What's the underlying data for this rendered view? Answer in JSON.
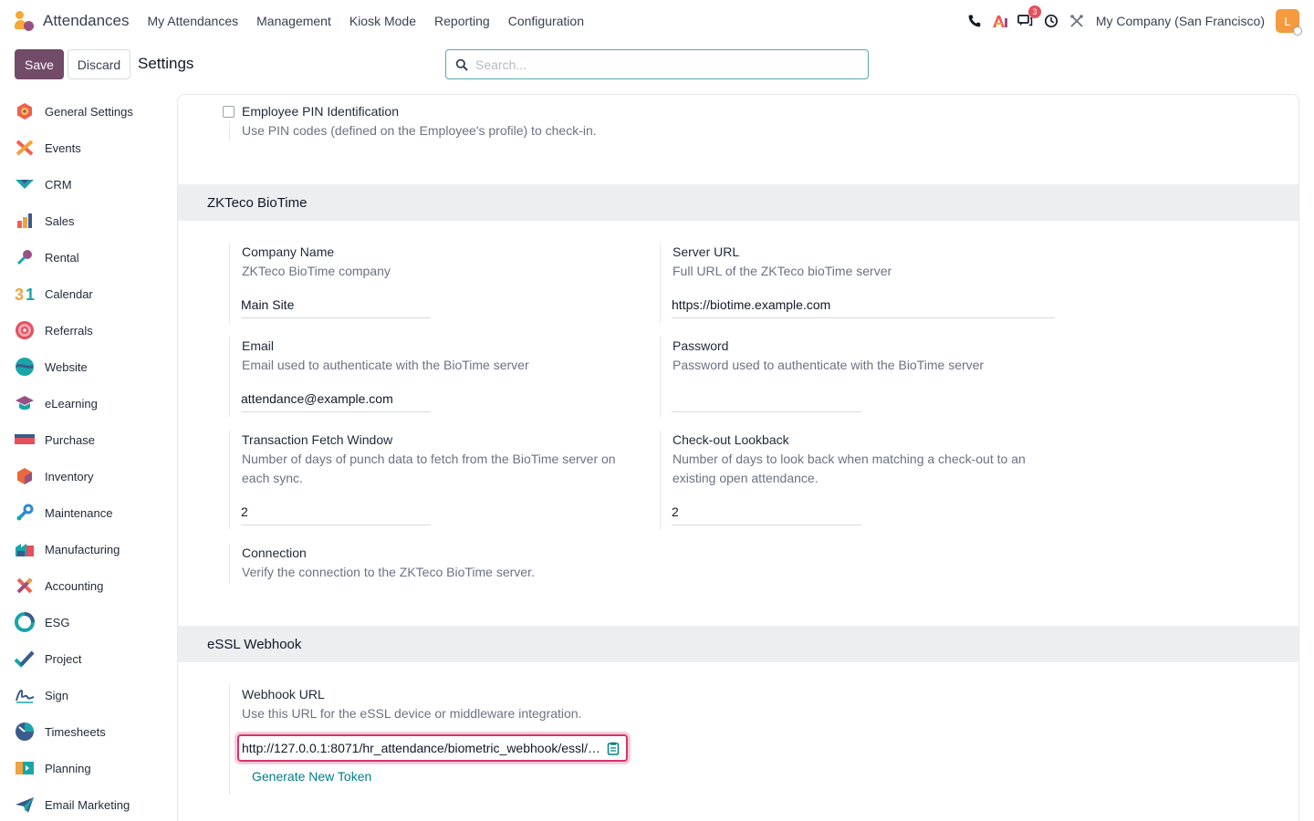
{
  "navbar": {
    "app_name": "Attendances",
    "menu": [
      "My Attendances",
      "Management",
      "Kiosk Mode",
      "Reporting",
      "Configuration"
    ],
    "messages_badge": "3",
    "company": "My Company (San Francisco)",
    "avatar_letter": "L"
  },
  "control": {
    "save_label": "Save",
    "discard_label": "Discard",
    "title": "Settings",
    "search_placeholder": "Search..."
  },
  "sidebar": {
    "items": [
      {
        "label": "General Settings",
        "icon": "general-settings-icon",
        "color": "#F06050"
      },
      {
        "label": "Events",
        "icon": "events-icon",
        "color": "#F06050"
      },
      {
        "label": "CRM",
        "icon": "crm-icon",
        "color": "#1AA5A9"
      },
      {
        "label": "Sales",
        "icon": "sales-icon",
        "color": "#F0A23E"
      },
      {
        "label": "Rental",
        "icon": "rental-icon",
        "color": "#985184"
      },
      {
        "label": "Calendar",
        "icon": "calendar-icon",
        "color": "#F0A23E"
      },
      {
        "label": "Referrals",
        "icon": "referrals-icon",
        "color": "#E4505C"
      },
      {
        "label": "Website",
        "icon": "website-icon",
        "color": "#1AA5A9"
      },
      {
        "label": "eLearning",
        "icon": "elearning-icon",
        "color": "#985184"
      },
      {
        "label": "Purchase",
        "icon": "purchase-icon",
        "color": "#3A5B8C"
      },
      {
        "label": "Inventory",
        "icon": "inventory-icon",
        "color": "#E96A3D"
      },
      {
        "label": "Maintenance",
        "icon": "maintenance-icon",
        "color": "#2A8CCB"
      },
      {
        "label": "Manufacturing",
        "icon": "manufacturing-icon",
        "color": "#1AA5A9"
      },
      {
        "label": "Accounting",
        "icon": "accounting-icon",
        "color": "#F06050"
      },
      {
        "label": "ESG",
        "icon": "esg-icon",
        "color": "#1AA5A9"
      },
      {
        "label": "Project",
        "icon": "project-icon",
        "color": "#1AA5A9"
      },
      {
        "label": "Sign",
        "icon": "sign-icon",
        "color": "#3A5B8C"
      },
      {
        "label": "Timesheets",
        "icon": "timesheets-icon",
        "color": "#3A5B8C"
      },
      {
        "label": "Planning",
        "icon": "planning-icon",
        "color": "#F0A23E"
      },
      {
        "label": "Email Marketing",
        "icon": "email-marketing-icon",
        "color": "#3A5B8C"
      }
    ]
  },
  "settings": {
    "pin": {
      "title": "Employee PIN Identification",
      "desc": "Use PIN codes (defined on the Employee's profile) to check-in.",
      "checked": false
    },
    "zkteco": {
      "heading": "ZKTeco BioTime",
      "company_name": {
        "title": "Company Name",
        "desc": "ZKTeco BioTime company",
        "value": "Main Site"
      },
      "server_url": {
        "title": "Server URL",
        "desc": "Full URL of the ZKTeco bioTime server",
        "value": "https://biotime.example.com"
      },
      "email": {
        "title": "Email",
        "desc": "Email used to authenticate with the BioTime server",
        "value": "attendance@example.com"
      },
      "password": {
        "title": "Password",
        "desc": "Password used to authenticate with the BioTime server",
        "value": ""
      },
      "fetch_window": {
        "title": "Transaction Fetch Window",
        "desc_line1": "Number of days of punch data to fetch from the BioTime server on",
        "desc_line2": "each sync.",
        "value": "2"
      },
      "lookback": {
        "title": "Check-out Lookback",
        "desc_line1": "Number of days to look back when matching a check-out to an",
        "desc_line2": "existing open attendance.",
        "value": "2"
      },
      "connection": {
        "title": "Connection",
        "desc": "Verify the connection to the ZKTeco BioTime server."
      }
    },
    "essl": {
      "heading": "eSSL Webhook",
      "webhook": {
        "title": "Webhook URL",
        "desc": "Use this URL for the eSSL device or middleware integration.",
        "value": "http://127.0.0.1:8071/hr_attendance/biometric_webhook/essl/…",
        "generate_label": "Generate New Token"
      }
    }
  }
}
